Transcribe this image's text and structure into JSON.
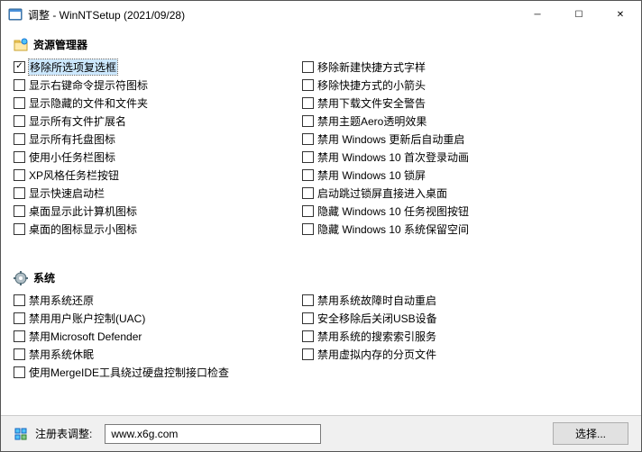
{
  "window": {
    "title": "调整 - WinNTSetup (2021/09/28)"
  },
  "sections": {
    "explorer": {
      "title": "资源管理器",
      "left": [
        {
          "label": "移除所选项复选框",
          "checked": true,
          "selected": true
        },
        {
          "label": "显示右键命令提示符图标",
          "checked": false
        },
        {
          "label": "显示隐藏的文件和文件夹",
          "checked": false
        },
        {
          "label": "显示所有文件扩展名",
          "checked": false
        },
        {
          "label": "显示所有托盘图标",
          "checked": false
        },
        {
          "label": "使用小任务栏图标",
          "checked": false
        },
        {
          "label": "XP风格任务栏按钮",
          "checked": false
        },
        {
          "label": "显示快速启动栏",
          "checked": false
        },
        {
          "label": "桌面显示此计算机图标",
          "checked": false
        },
        {
          "label": "桌面的图标显示小图标",
          "checked": false
        }
      ],
      "right": [
        {
          "label": "移除新建快捷方式字样",
          "checked": false
        },
        {
          "label": "移除快捷方式的小箭头",
          "checked": false
        },
        {
          "label": "禁用下载文件安全警告",
          "checked": false
        },
        {
          "label": "禁用主题Aero透明效果",
          "checked": false
        },
        {
          "label": "禁用 Windows 更新后自动重启",
          "checked": false
        },
        {
          "label": "禁用 Windows 10 首次登录动画",
          "checked": false
        },
        {
          "label": "禁用 Windows 10 锁屏",
          "checked": false
        },
        {
          "label": "启动跳过锁屏直接进入桌面",
          "checked": false
        },
        {
          "label": "隐藏 Windows 10 任务视图按钮",
          "checked": false
        },
        {
          "label": "隐藏 Windows 10 系统保留空间",
          "checked": false
        }
      ]
    },
    "system": {
      "title": "系统",
      "left": [
        {
          "label": "禁用系统还原",
          "checked": false
        },
        {
          "label": "禁用用户账户控制(UAC)",
          "checked": false
        },
        {
          "label": "禁用Microsoft Defender",
          "checked": false
        },
        {
          "label": "禁用系统休眠",
          "checked": false
        },
        {
          "label": "使用MergeIDE工具绕过硬盘控制接口检查",
          "checked": false
        }
      ],
      "right": [
        {
          "label": "禁用系统故障时自动重启",
          "checked": false
        },
        {
          "label": "安全移除后关闭USB设备",
          "checked": false
        },
        {
          "label": "禁用系统的搜索索引服务",
          "checked": false
        },
        {
          "label": "禁用虚拟内存的分页文件",
          "checked": false
        }
      ]
    }
  },
  "footer": {
    "label": "注册表调整:",
    "input_value": "www.x6g.com",
    "button": "选择..."
  }
}
